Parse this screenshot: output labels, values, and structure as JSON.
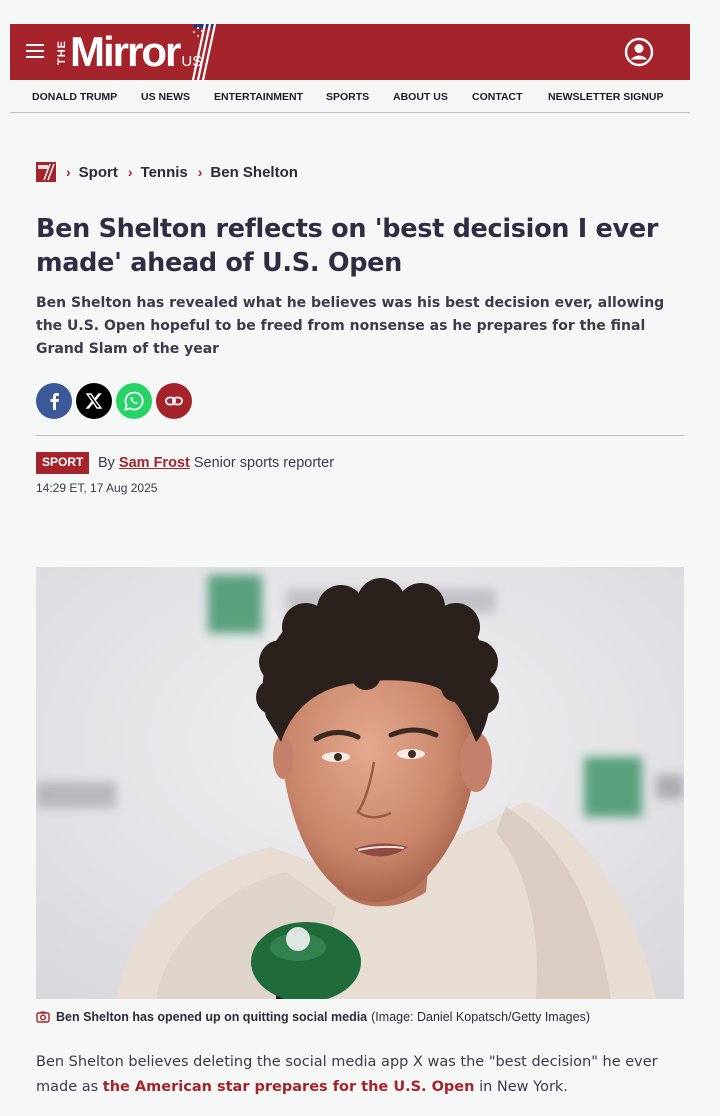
{
  "header": {
    "logo_the": "THE",
    "logo_main": "Mirror",
    "logo_us": "US"
  },
  "nav": {
    "items": [
      {
        "label": "DONALD TRUMP"
      },
      {
        "label": "US NEWS"
      },
      {
        "label": "ENTERTAINMENT"
      },
      {
        "label": "SPORTS"
      },
      {
        "label": "ABOUT US"
      },
      {
        "label": "CONTACT"
      },
      {
        "label": "NEWSLETTER SIGNUP"
      }
    ]
  },
  "breadcrumb": {
    "items": [
      "Sport",
      "Tennis",
      "Ben Shelton"
    ]
  },
  "article": {
    "headline": "Ben Shelton reflects on 'best decision I ever made' ahead of U.S. Open",
    "standfirst": "Ben Shelton has revealed what he believes was his best decision ever, allowing the U.S. Open hopeful to be freed from nonsense as he prepares for the final Grand Slam of the year",
    "section_badge": "SPORT",
    "byline_prefix": "By",
    "author": "Sam Frost",
    "author_role": "Senior sports reporter",
    "timestamp": "14:29 ET, 17 Aug 2025",
    "caption_bold": "Ben Shelton has opened up on quitting social media",
    "caption_credit": "(Image: Daniel Kopatsch/Getty Images)",
    "body_text_1": "Ben Shelton believes deleting the social media app X was the \"best decision\" he ever made as ",
    "body_link": "the American star prepares for the U.S. Open",
    "body_text_2": " in New York."
  },
  "share": {
    "buttons": [
      "facebook-icon",
      "x-icon",
      "whatsapp-icon",
      "link-icon"
    ]
  },
  "colors": {
    "brand_red": "#a5232b",
    "facebook": "#3b5998",
    "whatsapp": "#25d366",
    "x": "#000000"
  }
}
